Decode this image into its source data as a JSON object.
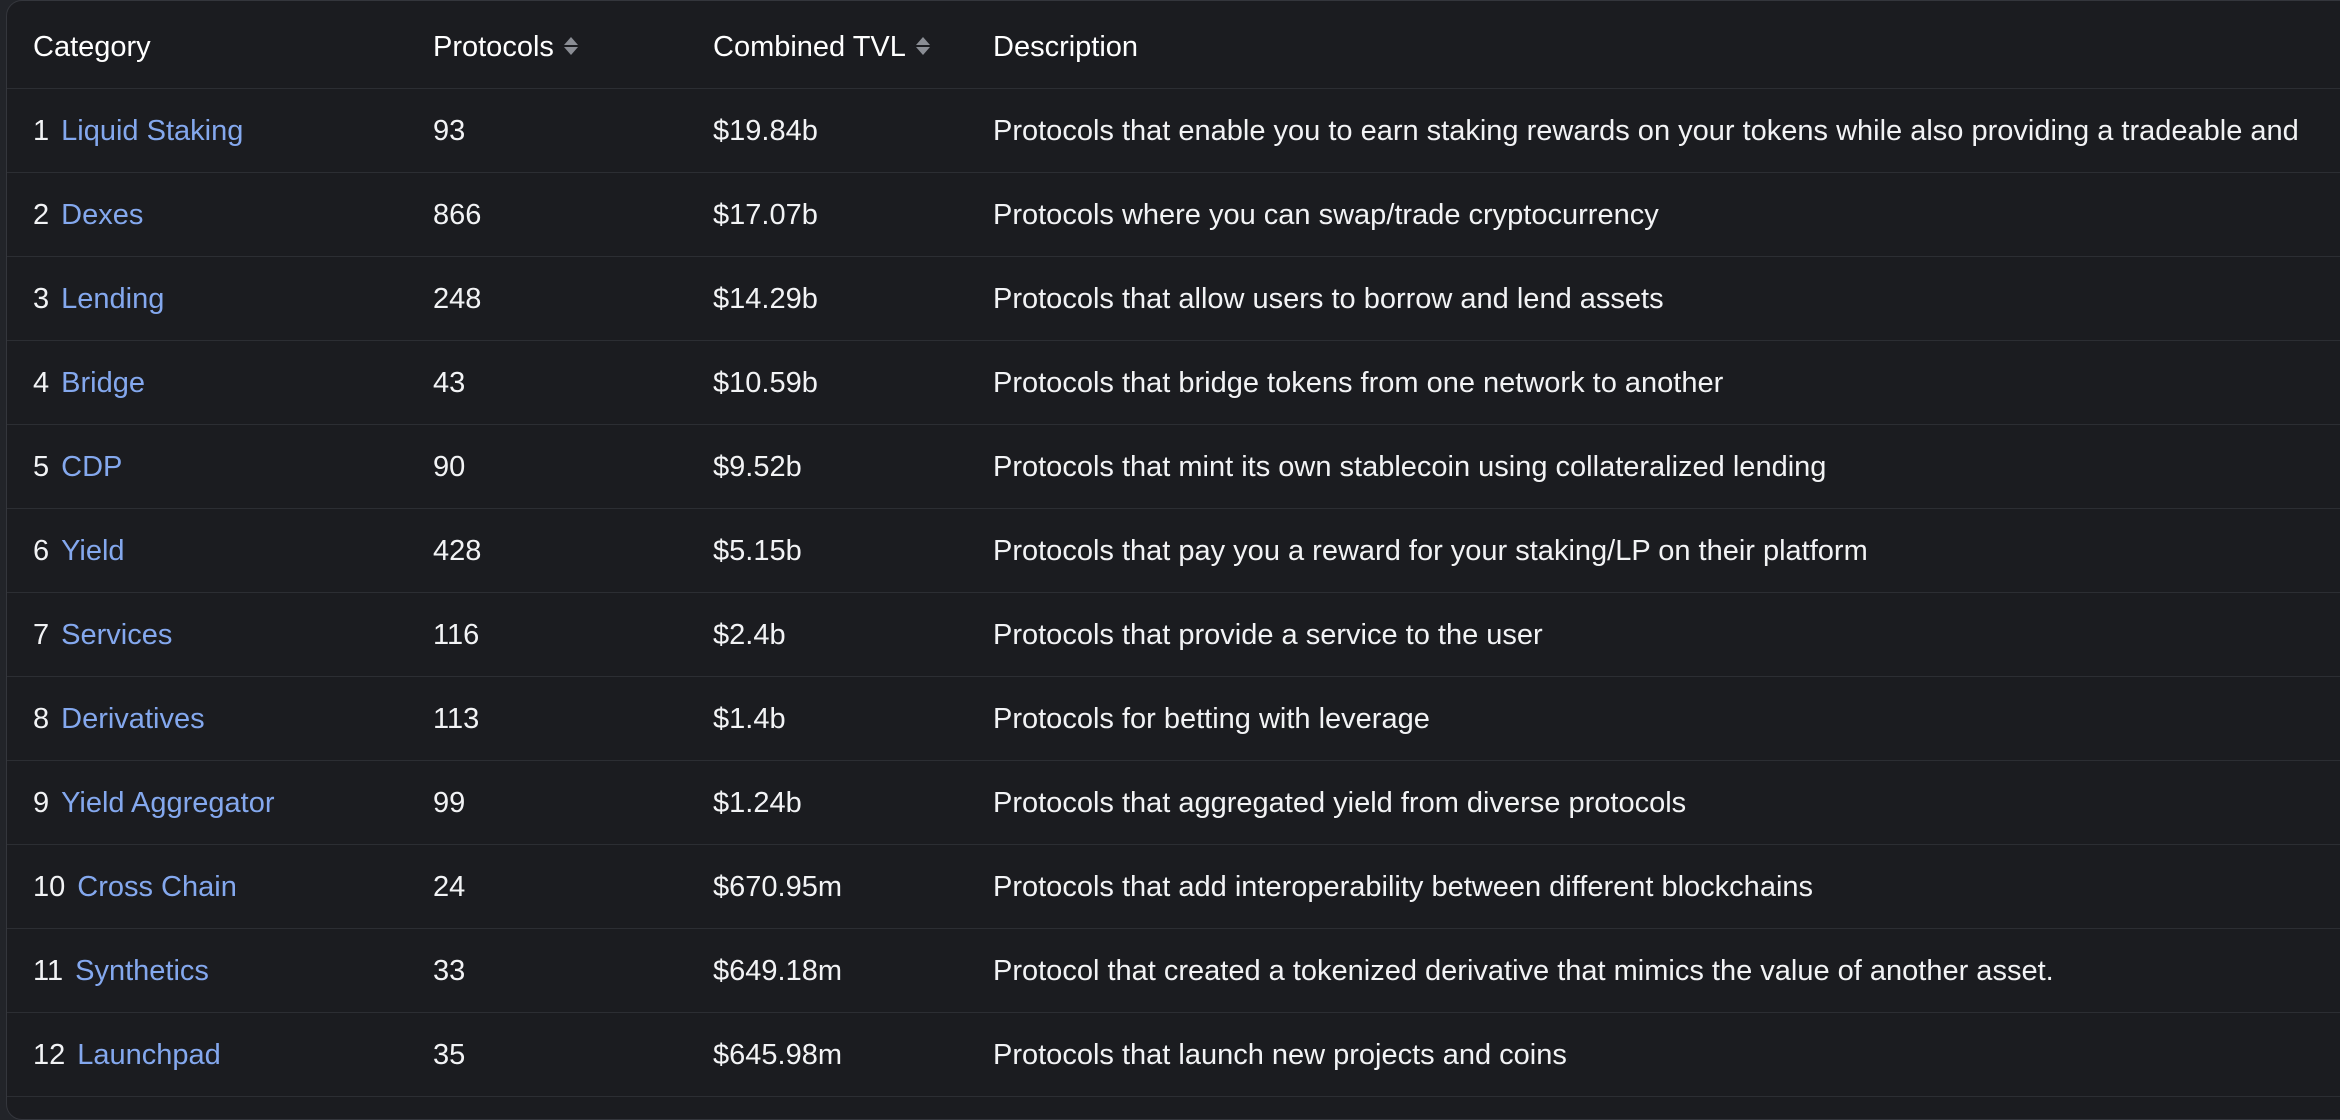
{
  "table": {
    "headers": {
      "category": "Category",
      "protocols": "Protocols",
      "tvl": "Combined TVL",
      "description": "Description"
    },
    "rows": [
      {
        "rank": "1",
        "category": "Liquid Staking",
        "protocols": "93",
        "tvl": "$19.84b",
        "description": "Protocols that enable you to earn staking rewards on your tokens while also providing a tradeable and"
      },
      {
        "rank": "2",
        "category": "Dexes",
        "protocols": "866",
        "tvl": "$17.07b",
        "description": "Protocols where you can swap/trade cryptocurrency"
      },
      {
        "rank": "3",
        "category": "Lending",
        "protocols": "248",
        "tvl": "$14.29b",
        "description": "Protocols that allow users to borrow and lend assets"
      },
      {
        "rank": "4",
        "category": "Bridge",
        "protocols": "43",
        "tvl": "$10.59b",
        "description": "Protocols that bridge tokens from one network to another"
      },
      {
        "rank": "5",
        "category": "CDP",
        "protocols": "90",
        "tvl": "$9.52b",
        "description": "Protocols that mint its own stablecoin using collateralized lending"
      },
      {
        "rank": "6",
        "category": "Yield",
        "protocols": "428",
        "tvl": "$5.15b",
        "description": "Protocols that pay you a reward for your staking/LP on their platform"
      },
      {
        "rank": "7",
        "category": "Services",
        "protocols": "116",
        "tvl": "$2.4b",
        "description": "Protocols that provide a service to the user"
      },
      {
        "rank": "8",
        "category": "Derivatives",
        "protocols": "113",
        "tvl": "$1.4b",
        "description": "Protocols for betting with leverage"
      },
      {
        "rank": "9",
        "category": "Yield Aggregator",
        "protocols": "99",
        "tvl": "$1.24b",
        "description": "Protocols that aggregated yield from diverse protocols"
      },
      {
        "rank": "10",
        "category": "Cross Chain",
        "protocols": "24",
        "tvl": "$670.95m",
        "description": "Protocols that add interoperability between different blockchains"
      },
      {
        "rank": "11",
        "category": "Synthetics",
        "protocols": "33",
        "tvl": "$649.18m",
        "description": "Protocol that created a tokenized derivative that mimics the value of another asset."
      },
      {
        "rank": "12",
        "category": "Launchpad",
        "protocols": "35",
        "tvl": "$645.98m",
        "description": "Protocols that launch new projects and coins"
      }
    ]
  },
  "colors": {
    "background": "#1b1c20",
    "link": "#84a8ee",
    "text": "#f2f3f5"
  }
}
